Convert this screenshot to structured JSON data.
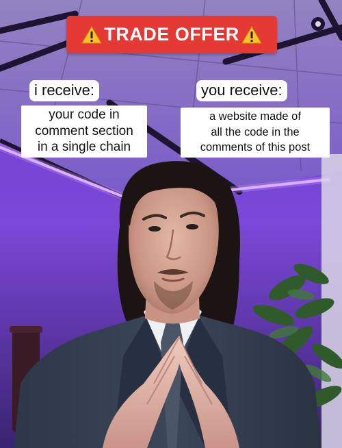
{
  "banner": {
    "text": "TRADE OFFER",
    "color": "#e53935",
    "icon": "warning-icon",
    "icon_color": "#fbc02d"
  },
  "left": {
    "label": "i receive:",
    "caption_lines": [
      "your code in",
      "comment section",
      "in a single chain"
    ]
  },
  "right": {
    "label": "you receive:",
    "caption_lines": [
      "a website made of",
      "all the code in the",
      "comments of this post"
    ]
  }
}
